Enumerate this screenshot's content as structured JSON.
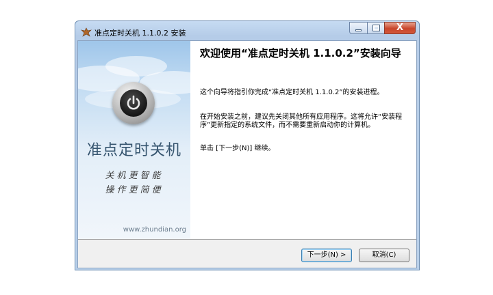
{
  "window": {
    "title": "准点定时关机 1.1.0.2 安装",
    "controls": {
      "close_glyph": "X"
    }
  },
  "sidebar": {
    "brand_name": "准点定时关机",
    "slogan_line1": "关机更智能",
    "slogan_line2": "操作更简便",
    "website": "www.zhundian.org",
    "logo_icon": "power-icon"
  },
  "content": {
    "heading": "欢迎使用“准点定时关机 1.1.0.2”安装向导",
    "paragraph1": "这个向导将指引你完成“准点定时关机 1.1.0.2”的安装进程。",
    "paragraph2": "在开始安装之前，建议先关闭其他所有应用程序。这将允许“安装程序”更新指定的系统文件，而不需要重新启动你的计算机。",
    "paragraph3": "单击 [下一步(N)] 继续。"
  },
  "buttons": {
    "next": "下一步(N) >",
    "cancel": "取消(C)"
  },
  "colors": {
    "title_bar": "#b8cfe9",
    "close_button": "#c8452b",
    "brand_text": "#36556f"
  }
}
